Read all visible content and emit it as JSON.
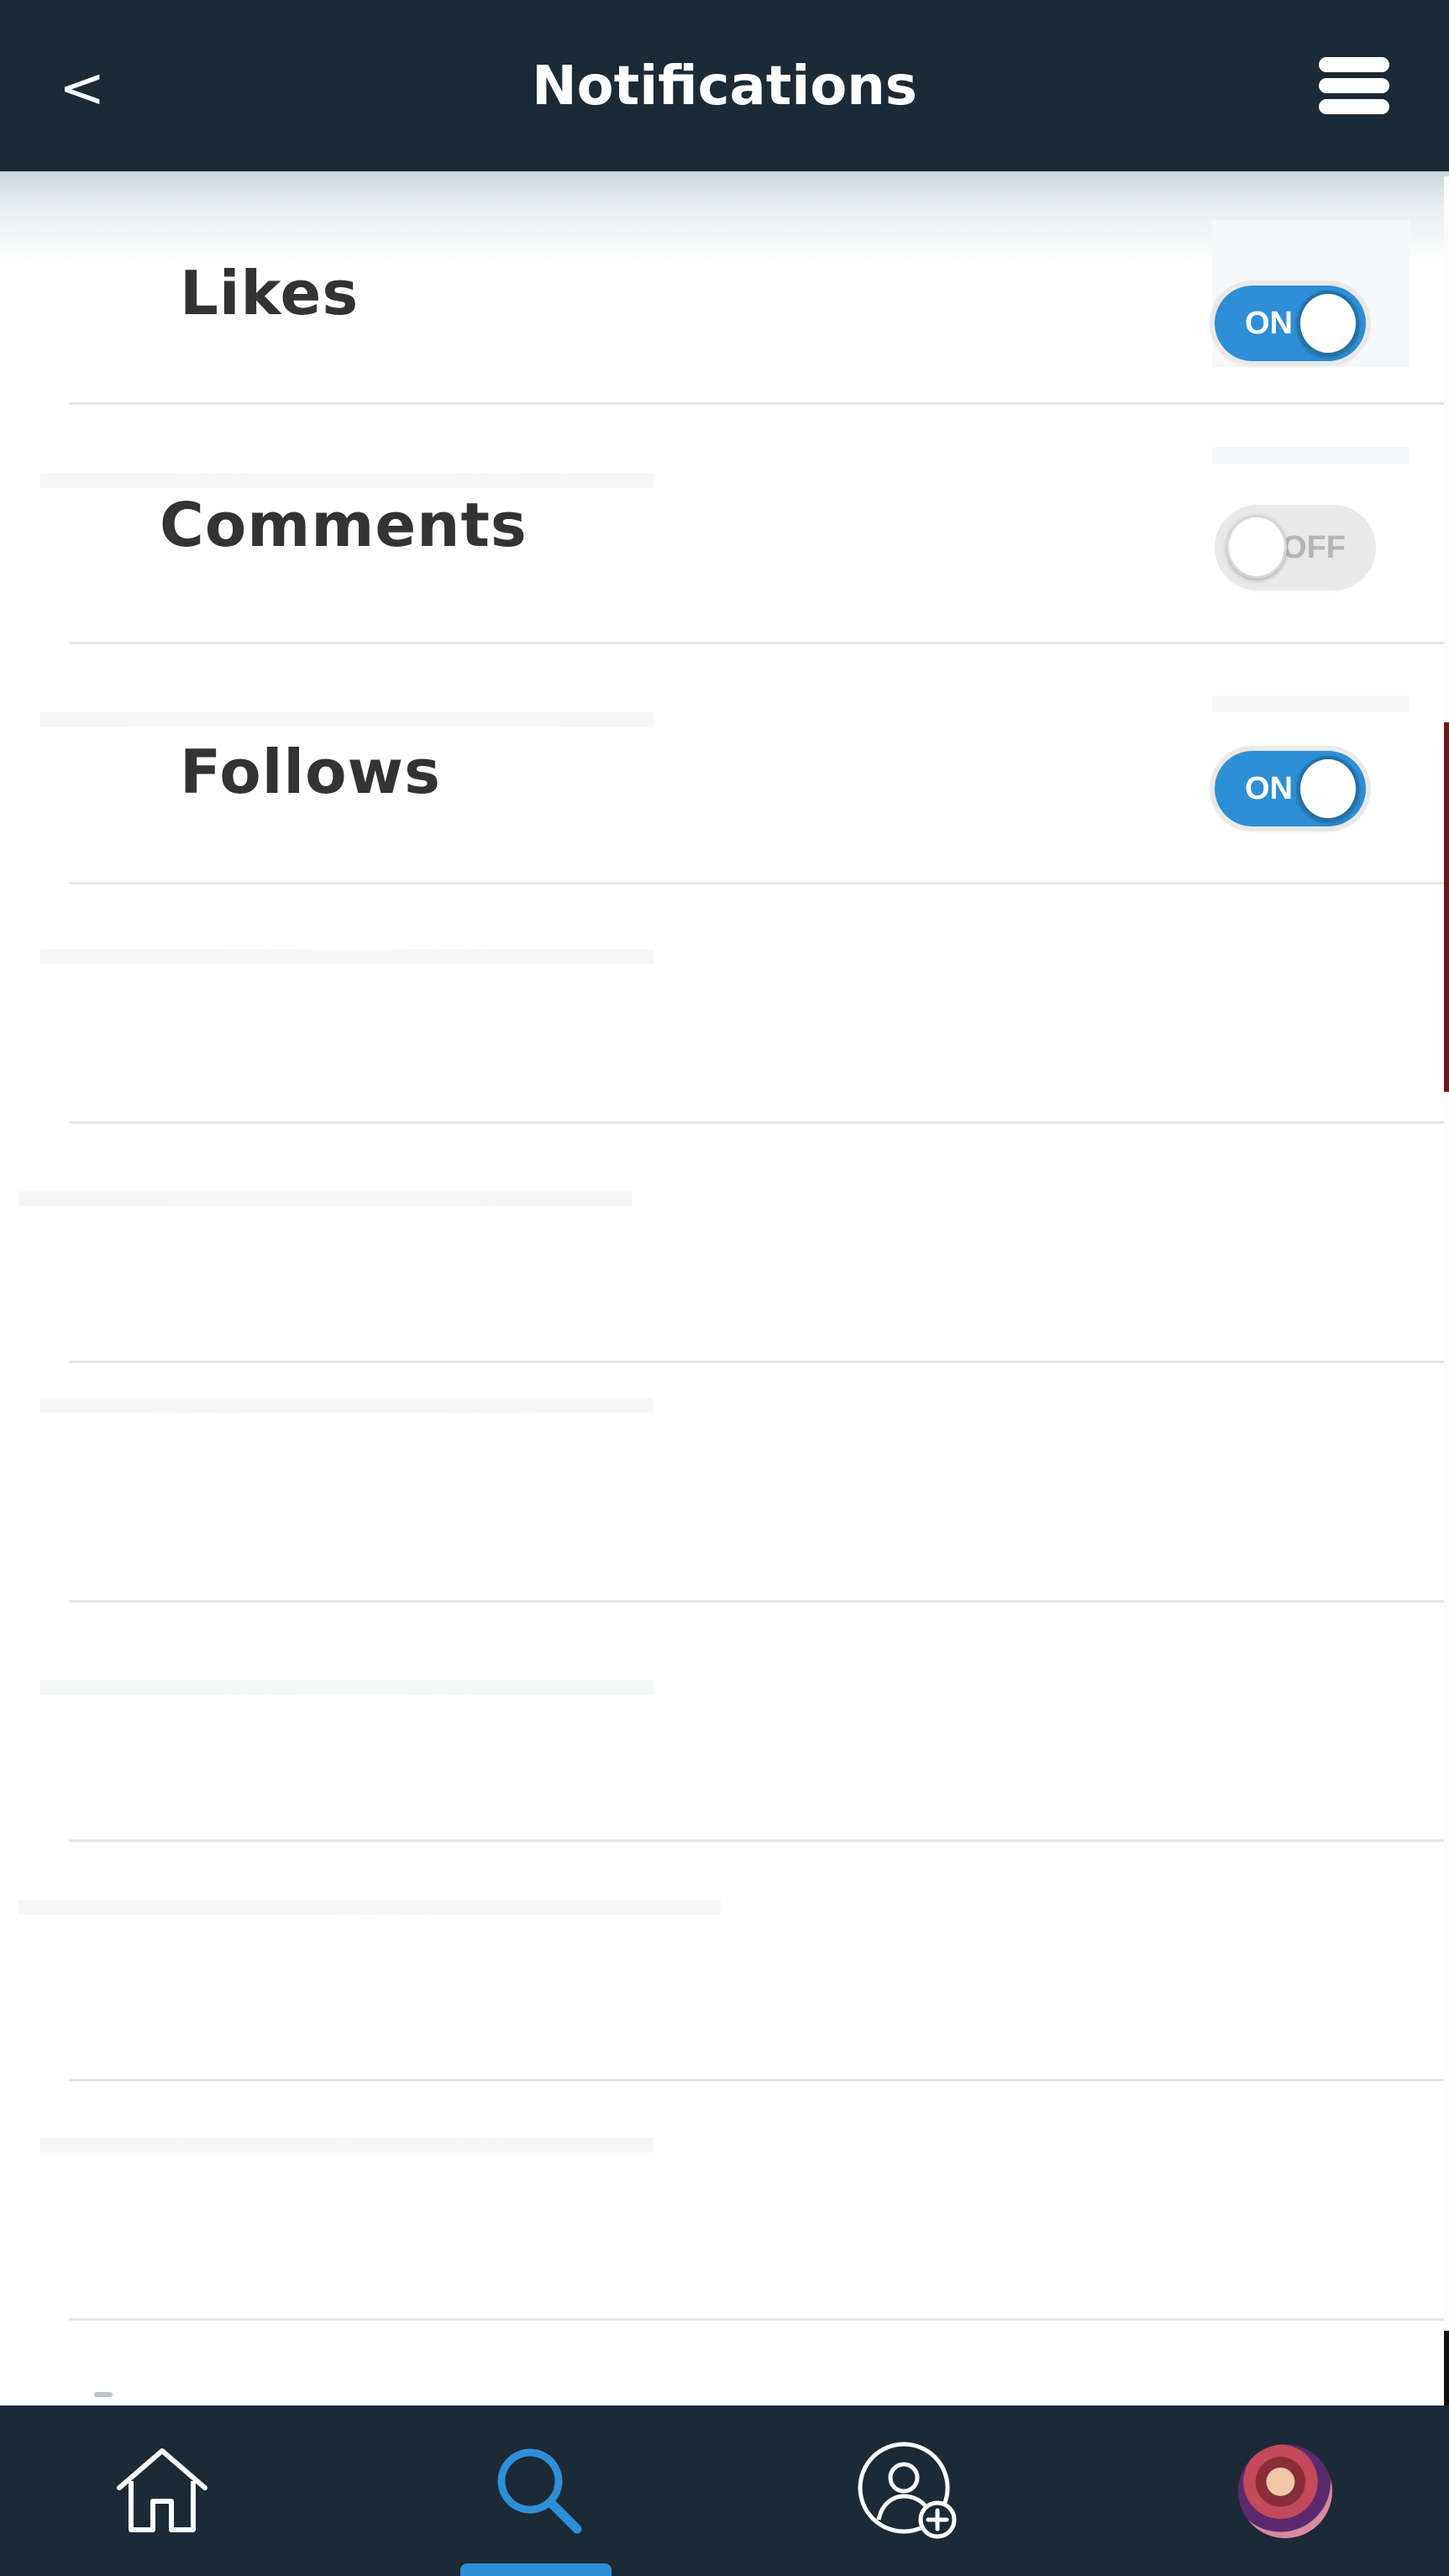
{
  "header": {
    "back_label": "<",
    "title": "Notifications",
    "menu_icon": "hamburger-menu-icon"
  },
  "settings": {
    "rows": [
      {
        "label": "Likes",
        "toggle": {
          "state": "on",
          "text": "ON"
        }
      },
      {
        "label": "Comments",
        "toggle": {
          "state": "off",
          "text": "OFF"
        }
      },
      {
        "label": "Follows",
        "toggle": {
          "state": "on",
          "text": "ON"
        }
      }
    ]
  },
  "bottom_nav": {
    "items": [
      {
        "icon": "home-icon",
        "active": false
      },
      {
        "icon": "search-icon",
        "active": true
      },
      {
        "icon": "add-user-icon",
        "active": false
      },
      {
        "icon": "profile-avatar",
        "active": false
      }
    ]
  },
  "colors": {
    "header_bg": "#1c2a35",
    "accent": "#2e8fd6",
    "label_text": "#333333",
    "toggle_off": "#e8e8e8"
  }
}
